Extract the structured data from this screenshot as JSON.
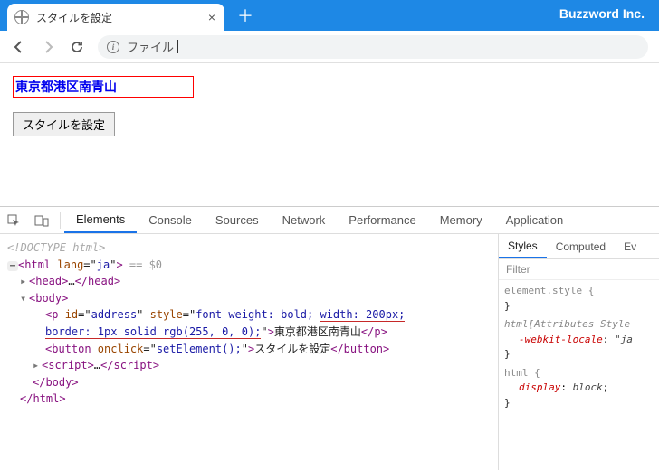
{
  "browser": {
    "tab_title": "スタイルを設定",
    "brand": "Buzzword Inc.",
    "new_tab_glyph": "＋",
    "close_glyph": "×"
  },
  "toolbar": {
    "address_prefix": "ファイル",
    "info_glyph": "i"
  },
  "page": {
    "address_text": "東京都港区南青山",
    "button_label": "スタイルを設定"
  },
  "devtools": {
    "tabs": {
      "elements": "Elements",
      "console": "Console",
      "sources": "Sources",
      "network": "Network",
      "performance": "Performance",
      "memory": "Memory",
      "application": "Application"
    },
    "dom": {
      "doctype": "<!DOCTYPE html>",
      "html_open": "<html lang=\"ja\">",
      "html_hint": " == $0",
      "head": "<head>…</head>",
      "body_open": "<body>",
      "p_open_1": "<p id=\"address\" style=\"font-weight: bold; ",
      "p_style_hl_1": "width: 200px;",
      "p_style_hl_2": "border: 1px solid rgb(255, 0, 0);",
      "p_open_2": "\">",
      "p_text": "東京都港区南青山",
      "p_close": "</p>",
      "button_open": "<button onclick=\"setElement();\">",
      "button_text": "スタイルを設定",
      "button_close": "</button>",
      "script": "<script>…</script>",
      "body_close": "</body>",
      "html_close": "</html>"
    },
    "styles": {
      "tabs": {
        "styles": "Styles",
        "computed": "Computed",
        "ev": "Ev"
      },
      "filter_placeholder": "Filter",
      "r1_sel": "element.style {",
      "r1_close": "}",
      "r2_sel": "html[Attributes Style",
      "r2_prop": "-webkit-locale",
      "r2_val": "\"ja",
      "r2_close": "}",
      "r3_sel": "html {",
      "r3_prop": "display",
      "r3_val": "block",
      "r3_close": "}"
    }
  }
}
